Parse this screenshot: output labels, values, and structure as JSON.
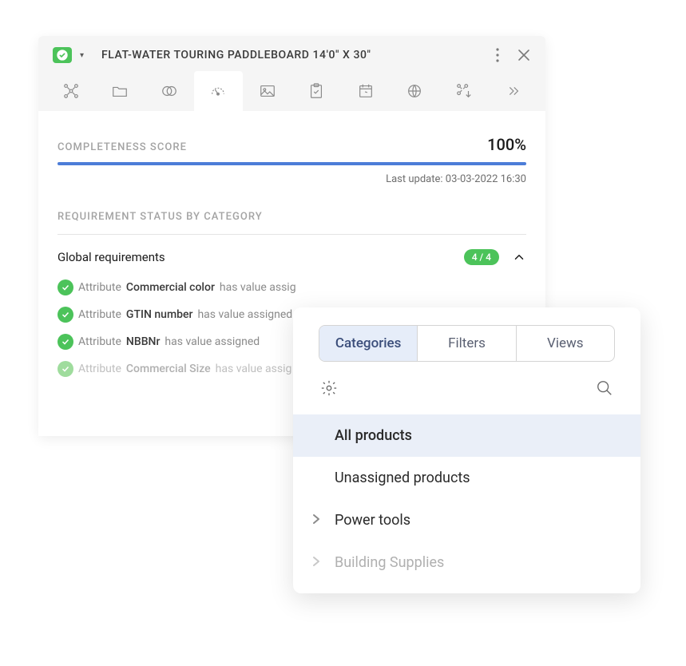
{
  "header": {
    "title": "FLAT-WATER TOURING PADDLEBOARD 14'0\" X 30\""
  },
  "score": {
    "label": "COMPLETENESS SCORE",
    "value": "100%",
    "last_update": "Last update: 03-03-2022 16:30"
  },
  "section_label": "REQUIREMENT STATUS BY CATEGORY",
  "requirements": {
    "title": "Global requirements",
    "badge": "4 / 4",
    "items": [
      {
        "label": "Attribute",
        "name": "Commercial color",
        "suffix": "has value assig",
        "faded": false
      },
      {
        "label": "Attribute",
        "name": "GTIN number",
        "suffix": "has value assigned",
        "faded": false
      },
      {
        "label": "Attribute",
        "name": "NBBNr",
        "suffix": "has value assigned",
        "faded": false
      },
      {
        "label": "Attribute",
        "name": "Commercial Size",
        "suffix": "has value assig",
        "faded": true
      }
    ]
  },
  "popup": {
    "tabs": [
      {
        "label": "Categories",
        "active": true
      },
      {
        "label": "Filters",
        "active": false
      },
      {
        "label": "Views",
        "active": false
      }
    ],
    "items": [
      {
        "label": "All products",
        "selected": true,
        "expandable": false,
        "faded": false
      },
      {
        "label": "Unassigned products",
        "selected": false,
        "expandable": false,
        "faded": false
      },
      {
        "label": "Power tools",
        "selected": false,
        "expandable": true,
        "faded": false
      },
      {
        "label": "Building Supplies",
        "selected": false,
        "expandable": true,
        "faded": true
      }
    ]
  }
}
